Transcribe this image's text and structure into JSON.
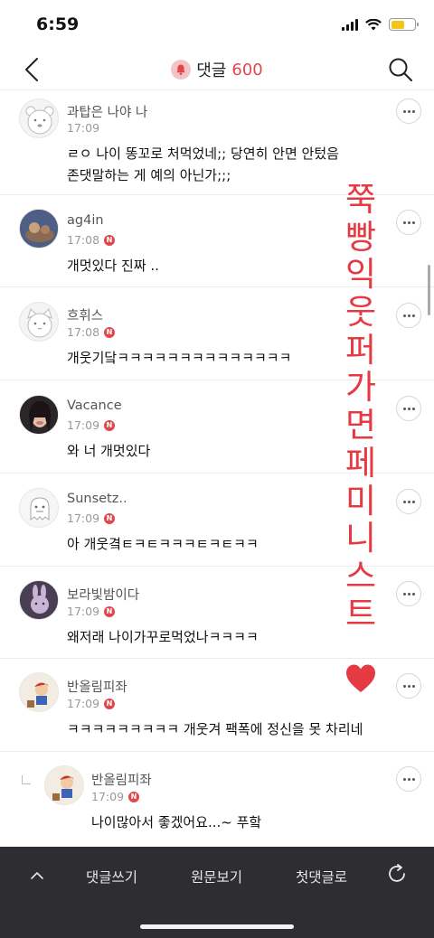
{
  "status": {
    "time": "6:59"
  },
  "header": {
    "title": "댓글",
    "count": "600"
  },
  "comments": [
    {
      "name": "과탑은 나야 나",
      "time": "17:09",
      "badge": "N",
      "body": "ㄹㅇ 나이 똥꼬로 처먹었네;; 당연히 안면 안텄음 존댓말하는 게 예의 아닌가;;;",
      "avatar": "bear-avatar"
    },
    {
      "name": "ag4in",
      "time": "17:08",
      "badge": "N",
      "body": "개멋있다 진짜 ..",
      "avatar": "photo-avatar"
    },
    {
      "name": "흐휘스",
      "time": "17:08",
      "badge": "N",
      "body": "개웃기닼ㅋㅋㅋㅋㅋㅋㅋㅋㅋㅋㅋㅋㅋㅋ",
      "avatar": "cat-avatar"
    },
    {
      "name": "Vacance",
      "time": "17:09",
      "badge": "N",
      "body": "와 너 개멋있다",
      "avatar": "person-avatar"
    },
    {
      "name": "Sunsetz..",
      "time": "17:09",
      "badge": "N",
      "body": "아 개웃곀ㅌㅋㅌㅋㅋㅋㅌㅋㅌㅋㅋ",
      "avatar": "ghost-avatar"
    },
    {
      "name": "보라빛밤이다",
      "time": "17:09",
      "badge": "N",
      "body": "왜저래 나이가꾸로먹었나ㅋㅋㅋㅋ",
      "avatar": "rabbit-avatar"
    },
    {
      "name": "반올림피좌",
      "time": "17:09",
      "badge": "N",
      "body": "ㅋㅋㅋㅋㅋㅋㅋㅋㅋ 개웃겨 팩폭에 정신을 못 차리네",
      "avatar": "cartoon-avatar"
    }
  ],
  "reply": {
    "name": "반올림피좌",
    "time": "17:09",
    "badge": "N",
    "body": "나이많아서 좋겠어요...~ 푸핰",
    "avatar": "cartoon-avatar"
  },
  "overlay": {
    "chars": [
      "쭉",
      "빵",
      "익",
      "웃",
      "퍼",
      "가",
      "면",
      "페",
      "미",
      "니",
      "스",
      "트"
    ],
    "color": "#e53a44"
  },
  "toolbar": {
    "write": "댓글쓰기",
    "view_original": "원문보기",
    "first_comment": "첫댓글로"
  },
  "colors": {
    "accent": "#e0474c",
    "toolbar_bg": "#2e2e32"
  }
}
